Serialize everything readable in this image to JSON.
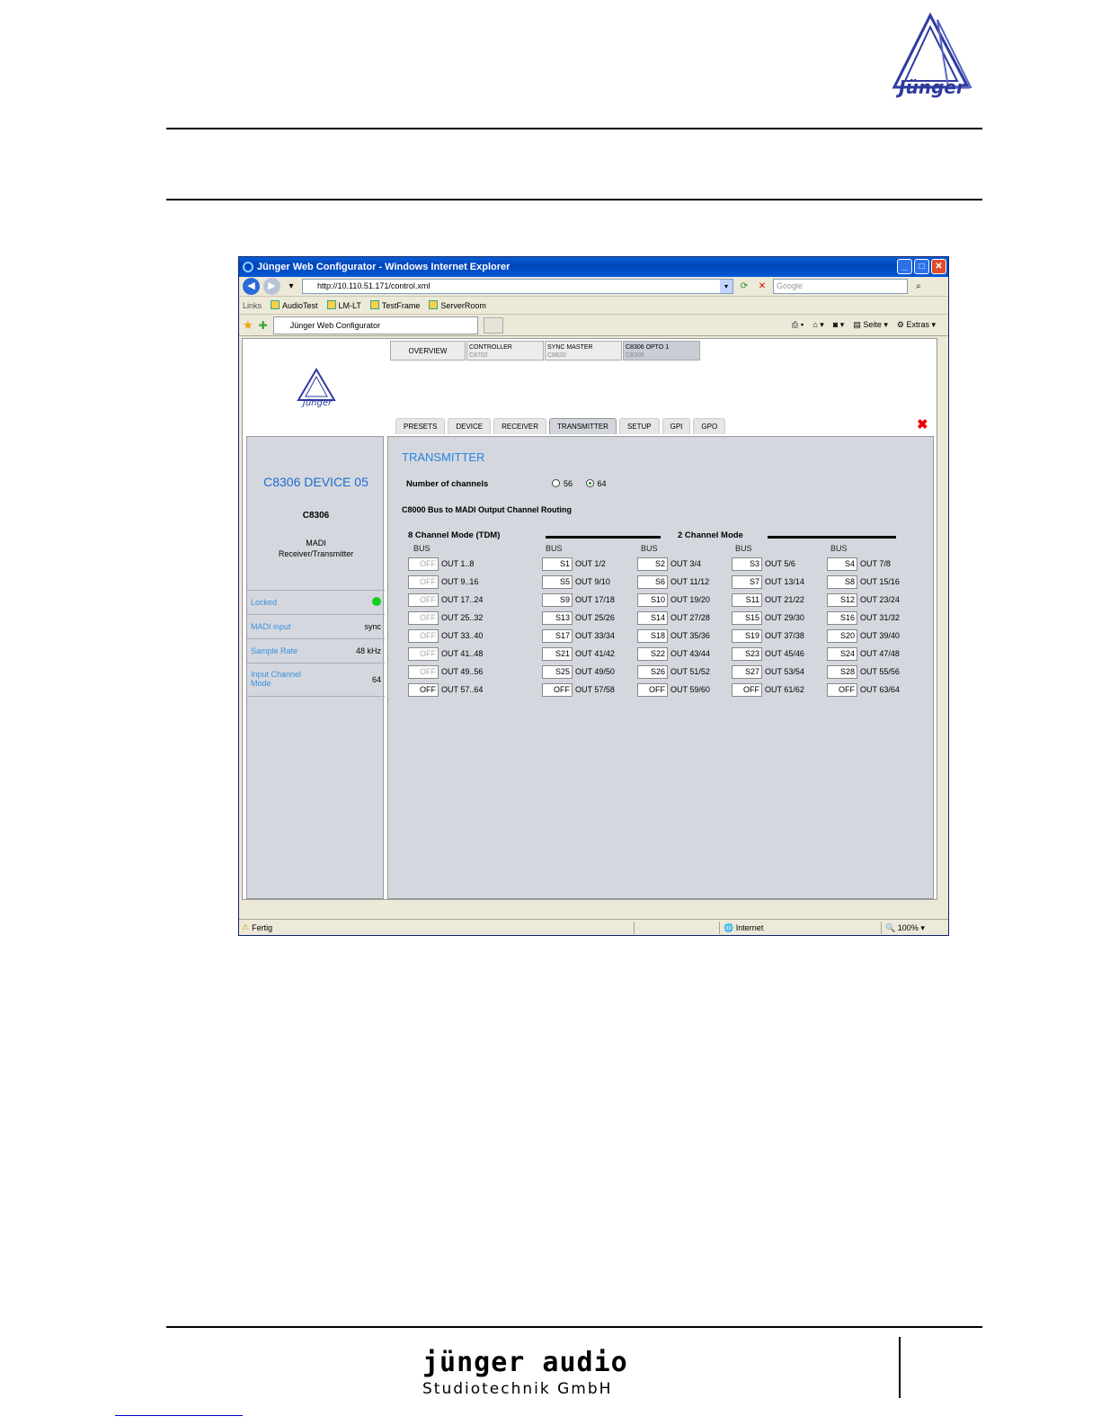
{
  "browser": {
    "window_title": "Jünger Web Configurator - Windows Internet Explorer",
    "url": "http://10.110.51.171/control.xml",
    "search_placeholder": "Google",
    "links_label": "Links",
    "links": [
      "AudioTest",
      "LM-LT",
      "TestFrame",
      "ServerRoom"
    ],
    "tab_title": "Jünger Web Configurator",
    "toolbar": {
      "page": "Seite",
      "tools": "Extras"
    },
    "status": {
      "text": "Fertig",
      "zone": "Internet",
      "zoom": "100%"
    }
  },
  "device_tabs": [
    {
      "name": "OVERVIEW",
      "sub": ""
    },
    {
      "name": "CONTROLLER",
      "sub": "C8702"
    },
    {
      "name": "SYNC MASTER",
      "sub": "C8820"
    },
    {
      "name": "C8306 OPTO 1",
      "sub": "C8306"
    }
  ],
  "page_tabs": [
    "PRESETS",
    "DEVICE",
    "RECEIVER",
    "TRANSMITTER",
    "SETUP",
    "GPI",
    "GPO"
  ],
  "active_page_tab": "TRANSMITTER",
  "device": {
    "name": "C8306 DEVICE 05",
    "model": "C8306",
    "description_line1": "MADI",
    "description_line2": "Receiver/Transmitter",
    "status": [
      {
        "label": "Locked",
        "value": ""
      },
      {
        "label": "MADI input",
        "value": "sync"
      },
      {
        "label": "Sample Rate",
        "value": "48 kHz"
      },
      {
        "label": "Input Channel Mode",
        "value": "64"
      }
    ],
    "locked_color": "#12d01a"
  },
  "transmitter": {
    "title": "TRANSMITTER",
    "num_channels_label": "Number of channels",
    "options": [
      "56",
      "64"
    ],
    "selected": "64",
    "routing_title": "C8000 Bus to MADI Output Channel Routing",
    "mode8_label": "8 Channel Mode (TDM)",
    "mode2_label": "2 Channel Mode",
    "bus_label": "BUS",
    "tdm": [
      {
        "bus": "OFF",
        "out": "OUT 1..8"
      },
      {
        "bus": "OFF",
        "out": "OUT 9..16"
      },
      {
        "bus": "OFF",
        "out": "OUT 17..24"
      },
      {
        "bus": "OFF",
        "out": "OUT 25..32"
      },
      {
        "bus": "OFF",
        "out": "OUT 33..40"
      },
      {
        "bus": "OFF",
        "out": "OUT 41..48"
      },
      {
        "bus": "OFF",
        "out": "OUT 49..56"
      },
      {
        "bus": "OFF",
        "out": "OUT 57..64"
      }
    ],
    "two_ch": [
      [
        {
          "bus": "S1",
          "out": "OUT 1/2"
        },
        {
          "bus": "S2",
          "out": "OUT 3/4"
        },
        {
          "bus": "S3",
          "out": "OUT 5/6"
        },
        {
          "bus": "S4",
          "out": "OUT 7/8"
        }
      ],
      [
        {
          "bus": "S5",
          "out": "OUT 9/10"
        },
        {
          "bus": "S6",
          "out": "OUT 11/12"
        },
        {
          "bus": "S7",
          "out": "OUT 13/14"
        },
        {
          "bus": "S8",
          "out": "OUT 15/16"
        }
      ],
      [
        {
          "bus": "S9",
          "out": "OUT 17/18"
        },
        {
          "bus": "S10",
          "out": "OUT 19/20"
        },
        {
          "bus": "S11",
          "out": "OUT 21/22"
        },
        {
          "bus": "S12",
          "out": "OUT 23/24"
        }
      ],
      [
        {
          "bus": "S13",
          "out": "OUT 25/26"
        },
        {
          "bus": "S14",
          "out": "OUT 27/28"
        },
        {
          "bus": "S15",
          "out": "OUT 29/30"
        },
        {
          "bus": "S16",
          "out": "OUT 31/32"
        }
      ],
      [
        {
          "bus": "S17",
          "out": "OUT 33/34"
        },
        {
          "bus": "S18",
          "out": "OUT 35/36"
        },
        {
          "bus": "S19",
          "out": "OUT 37/38"
        },
        {
          "bus": "S20",
          "out": "OUT 39/40"
        }
      ],
      [
        {
          "bus": "S21",
          "out": "OUT 41/42"
        },
        {
          "bus": "S22",
          "out": "OUT 43/44"
        },
        {
          "bus": "S23",
          "out": "OUT 45/46"
        },
        {
          "bus": "S24",
          "out": "OUT 47/48"
        }
      ],
      [
        {
          "bus": "S25",
          "out": "OUT 49/50"
        },
        {
          "bus": "S26",
          "out": "OUT 51/52"
        },
        {
          "bus": "S27",
          "out": "OUT 53/54"
        },
        {
          "bus": "S28",
          "out": "OUT 55/56"
        }
      ],
      [
        {
          "bus": "OFF",
          "out": "OUT 57/58"
        },
        {
          "bus": "OFF",
          "out": "OUT 59/60"
        },
        {
          "bus": "OFF",
          "out": "OUT 61/62"
        },
        {
          "bus": "OFF",
          "out": "OUT 63/64"
        }
      ]
    ]
  },
  "footer": {
    "brand_line1": "jünger audio",
    "brand_line2": "Studiotechnik GmbH"
  },
  "colors": {
    "accent": "#2b83e0",
    "panel": "#d4d8de",
    "titlebar": "#0a5fd8"
  }
}
